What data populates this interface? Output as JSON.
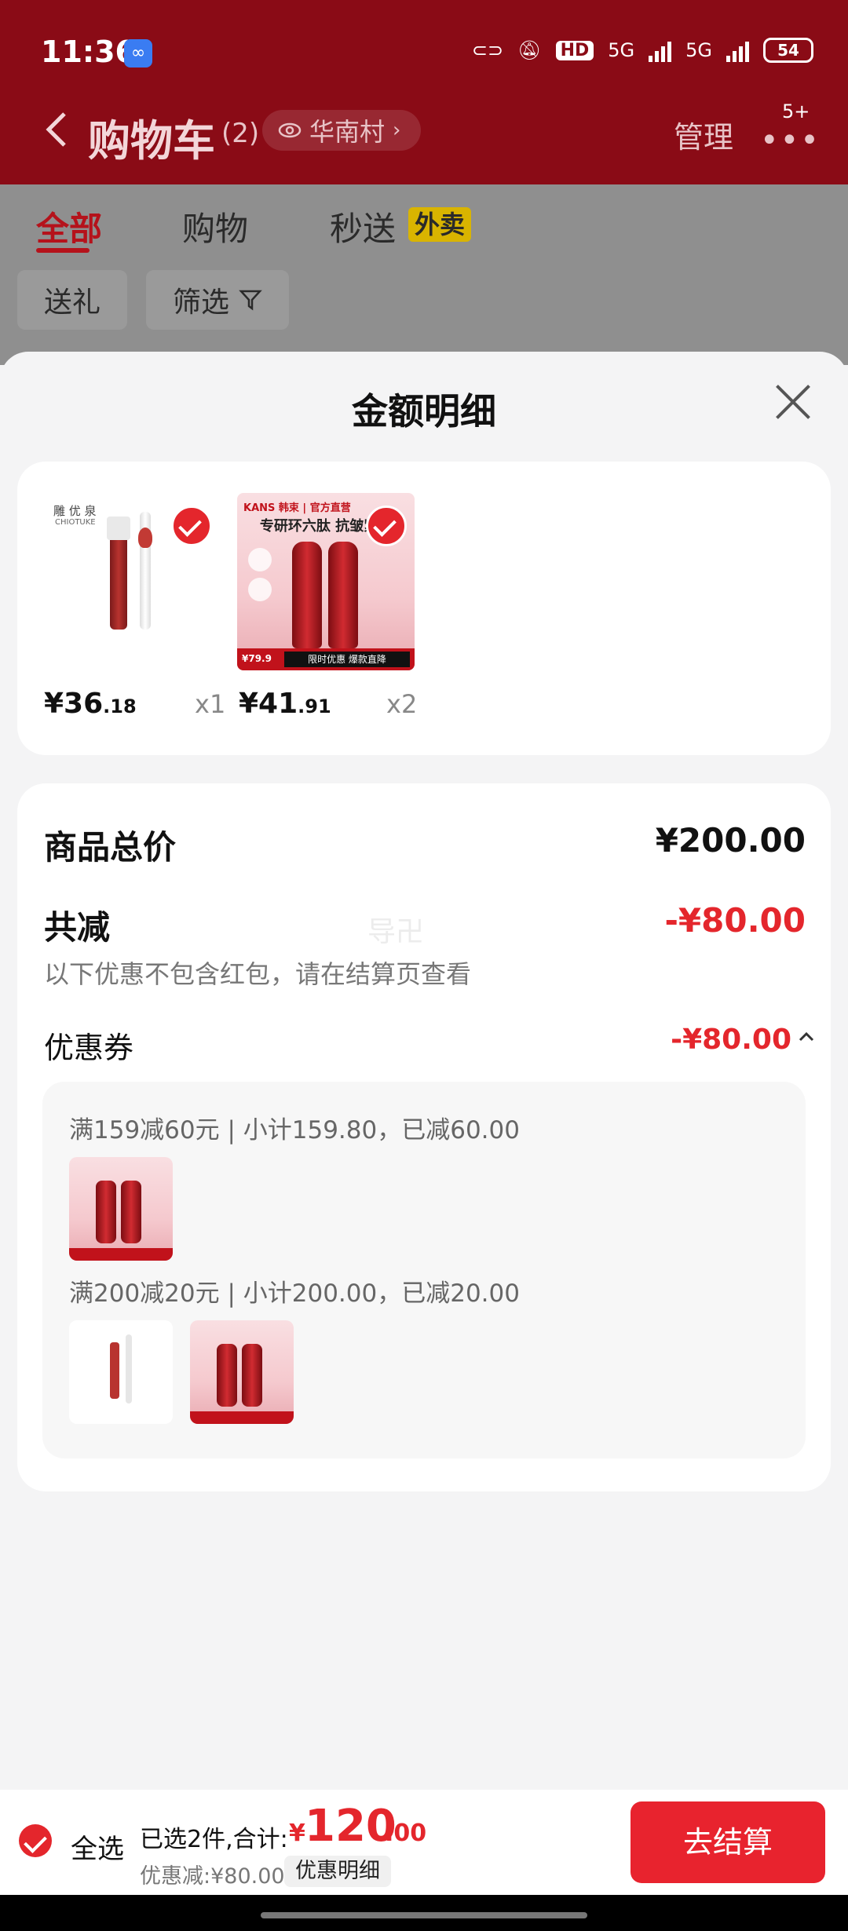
{
  "status_bar": {
    "time": "11:36",
    "hd": "HD",
    "net1": "5G",
    "net2": "5G",
    "battery": "54"
  },
  "header": {
    "back_icon": "chevron-left-icon",
    "title": "购物车",
    "count": "(2)",
    "location": "华南村",
    "manage": "管理",
    "more_badge": "5+"
  },
  "tabs": [
    {
      "label": "全部",
      "active": true
    },
    {
      "label": "购物",
      "active": false
    },
    {
      "label": "秒送",
      "active": false
    }
  ],
  "waimai_badge": "外卖",
  "filters": {
    "gift": "送礼",
    "filter": "筛选"
  },
  "sheet": {
    "title": "金额明细",
    "products": [
      {
        "brand": "雕 优 泉",
        "brand_en": "CHIOTUKE",
        "price_main": "¥36",
        "price_dec": ".18",
        "qty": "x1"
      },
      {
        "brand": "KANS 韩束 | 官方直营",
        "headline": "专研环六肽 抗皱紧致",
        "badge_price": "¥79.9",
        "banner": "限时优惠 爆款直降",
        "price_main": "¥41",
        "price_dec": ".91",
        "qty": "x2"
      }
    ],
    "total_label": "商品总价",
    "total_value": "¥200.00",
    "discount_label": "共减",
    "discount_value": "-¥80.00",
    "discount_note": "以下优惠不包含红包，请在结算页查看",
    "watermark": "导卍",
    "coupon_label": "优惠券",
    "coupon_value": "-¥80.00",
    "coupon_rules": [
      {
        "text": "满159减60元 | 小计159.80，已减60.00"
      },
      {
        "text": "满200减20元 | 小计200.00，已减20.00"
      }
    ]
  },
  "bottom_bar": {
    "select_all": "全选",
    "selected_text": "已选2件,合计:",
    "currency": "¥",
    "total_int": "120",
    "total_dec": ".00",
    "discount_text": "优惠减:¥80.00",
    "detail_btn": "优惠明细",
    "checkout": "去结算"
  },
  "colors": {
    "accent": "#e4262c",
    "header": "#8a0b16"
  }
}
